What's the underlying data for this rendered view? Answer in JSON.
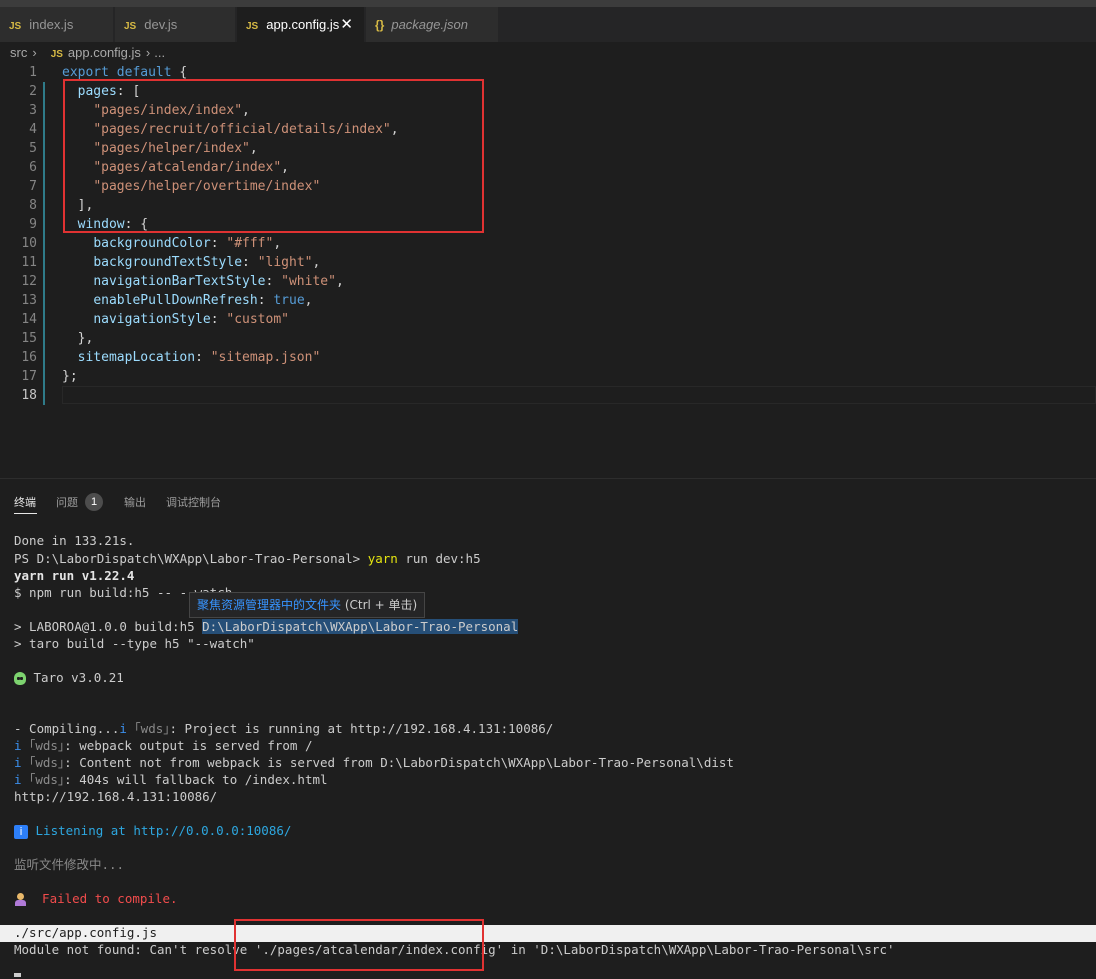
{
  "tabs": [
    {
      "label": "index.js",
      "icon": "JS",
      "active": false
    },
    {
      "label": "dev.js",
      "icon": "JS",
      "active": false
    },
    {
      "label": "app.config.js",
      "icon": "JS",
      "active": true
    },
    {
      "label": "package.json",
      "icon": "{}",
      "active": false
    }
  ],
  "close_glyph": "✕",
  "breadcrumb": {
    "folder": "src",
    "file_icon": "JS",
    "file": "app.config.js",
    "more": "..."
  },
  "editor": {
    "line_numbers": [
      "1",
      "2",
      "3",
      "4",
      "5",
      "6",
      "7",
      "8",
      "9",
      "10",
      "11",
      "12",
      "13",
      "14",
      "15",
      "16",
      "17",
      "18"
    ],
    "tokens": {
      "export": "export",
      "default": "default",
      "open_brace": " {",
      "pages_key": "pages",
      "pages_open": ": [",
      "page1": "\"pages/index/index\"",
      "page2": "\"pages/recruit/official/details/index\"",
      "page3": "\"pages/helper/index\"",
      "page4": "\"pages/atcalendar/index\"",
      "page5": "\"pages/helper/overtime/index\"",
      "comma": ",",
      "pages_close": "],",
      "window_key": "window",
      "window_open": ": {",
      "bg_key": "backgroundColor",
      "bg_val": "\"#fff\"",
      "bgts_key": "backgroundTextStyle",
      "bgts_val": "\"light\"",
      "nbts_key": "navigationBarTextStyle",
      "nbts_val": "\"white\"",
      "epdr_key": "enablePullDownRefresh",
      "epdr_val": "true",
      "ns_key": "navigationStyle",
      "ns_val": "\"custom\"",
      "window_close": "},",
      "sitemap_key": "sitemapLocation",
      "sitemap_val": "\"sitemap.json\"",
      "colon": ": ",
      "end": "};"
    }
  },
  "panel": {
    "tabs": [
      "终端",
      "问题",
      "输出",
      "调试控制台"
    ],
    "problems_count": "1"
  },
  "terminal": {
    "done": "Done in 133.21s.",
    "prompt": "PS D:\\LaborDispatch\\WXApp\\Labor-Trao-Personal> ",
    "cmd_yarn": "yarn",
    "cmd_rest": " run dev:h5",
    "yarn_version": "yarn run v1.22.4",
    "npm_cmd": "$ npm run build:h5 -- --watch",
    "laboroa_prefix": "> LABOROA@1.0.0 build:h5 ",
    "laboroa_path": "D:\\LaborDispatch\\WXApp\\Labor-Trao-Personal",
    "taro_cmd": "> taro build --type h5 \"--watch\"",
    "taro_version": " Taro v3.0.21",
    "compiling": "- Compiling...",
    "i": "i",
    "wds": "｢wds｣",
    "running": ": Project is running at http://192.168.4.131:10086/",
    "webpack_output": ": webpack output is served from /",
    "content": ": Content not from webpack is served from D:\\LaborDispatch\\WXApp\\Labor-Trao-Personal\\dist",
    "fallback": ": 404s will fallback to /index.html",
    "url": "http://192.168.4.131:10086/",
    "listening": " Listening at http://0.0.0.0:10086/",
    "watching": "监听文件修改中...",
    "failed": "  Failed to compile.",
    "src_file": "./src/app.config.js",
    "module_not_found": "Module not found: Can't resolve './pages/atcalendar/index.config' in 'D:\\LaborDispatch\\WXApp\\Labor-Trao-Personal\\src'"
  },
  "tooltip": {
    "link": "聚焦资源管理器中的文件夹",
    "hint": " (Ctrl + 单击)"
  }
}
